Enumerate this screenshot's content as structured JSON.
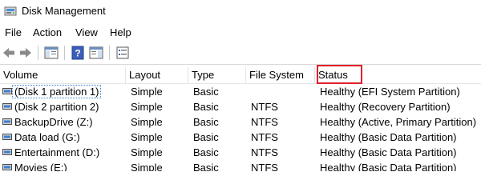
{
  "window": {
    "title": "Disk Management"
  },
  "menu": {
    "items": [
      {
        "label": "File"
      },
      {
        "label": "Action"
      },
      {
        "label": "View"
      },
      {
        "label": "Help"
      }
    ]
  },
  "toolbar": {
    "buttons": [
      {
        "icon": "back-arrow-icon"
      },
      {
        "icon": "forward-arrow-icon"
      },
      {
        "icon": "show-hide-console-tree-icon"
      },
      {
        "icon": "help-icon"
      },
      {
        "icon": "show-hide-action-pane-icon"
      },
      {
        "icon": "properties-icon"
      }
    ]
  },
  "table": {
    "columns": [
      "Volume",
      "Layout",
      "Type",
      "File System",
      "Status"
    ],
    "highlighted_column": "Status",
    "highlight_color": "#e0202a",
    "rows": [
      {
        "volume": "(Disk 1 partition 1)",
        "layout": "Simple",
        "type": "Basic",
        "fs": "",
        "status": "Healthy (EFI System Partition)",
        "selected": true
      },
      {
        "volume": "(Disk 2 partition 2)",
        "layout": "Simple",
        "type": "Basic",
        "fs": "NTFS",
        "status": "Healthy (Recovery Partition)"
      },
      {
        "volume": "BackupDrive (Z:)",
        "layout": "Simple",
        "type": "Basic",
        "fs": "NTFS",
        "status": "Healthy (Active, Primary Partition)"
      },
      {
        "volume": "Data load (G:)",
        "layout": "Simple",
        "type": "Basic",
        "fs": "NTFS",
        "status": "Healthy (Basic Data Partition)"
      },
      {
        "volume": "Entertainment (D:)",
        "layout": "Simple",
        "type": "Basic",
        "fs": "NTFS",
        "status": "Healthy (Basic Data Partition)"
      },
      {
        "volume": "Movies (E:)",
        "layout": "Simple",
        "type": "Basic",
        "fs": "NTFS",
        "status": "Healthy (Basic Data Partition)"
      }
    ]
  }
}
